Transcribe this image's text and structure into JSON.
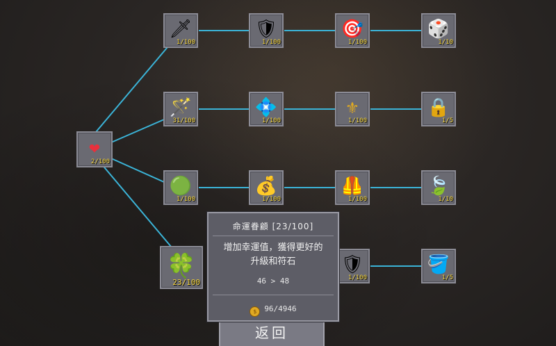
{
  "skill_tree": {
    "root": {
      "icon": "heart-hp-icon",
      "glyph": "❤",
      "count": "2/100"
    },
    "rows": [
      [
        {
          "icon": "sword-icon",
          "glyph": "🗡",
          "count": "1/100"
        },
        {
          "icon": "shield-icon",
          "glyph": "🛡",
          "count": "1/100"
        },
        {
          "icon": "target-icon",
          "glyph": "🎯",
          "count": "1/100"
        },
        {
          "icon": "d20-dice-icon",
          "glyph": "🎲",
          "count": "1/10"
        }
      ],
      [
        {
          "icon": "magic-staff-icon",
          "glyph": "🪄",
          "count": "31/100"
        },
        {
          "icon": "crystal-glass-icon",
          "glyph": "💠",
          "count": "1/100"
        },
        {
          "icon": "slingshot-icon",
          "glyph": "⚜",
          "count": "1/100"
        },
        {
          "icon": "padlock-icon",
          "glyph": "🔒",
          "count": "1/5"
        }
      ],
      [
        {
          "icon": "green-orb-icon",
          "glyph": "🟢",
          "count": "1/100"
        },
        {
          "icon": "money-bag-icon",
          "glyph": "💰",
          "count": "1/100"
        },
        {
          "icon": "armor-icon",
          "glyph": "🦺",
          "count": "1/100"
        },
        {
          "icon": "leaf-icon",
          "glyph": "🍃",
          "count": "1/10"
        }
      ],
      [
        {
          "icon": "four-leaf-clover-icon",
          "glyph": "🍀",
          "count": "23/100"
        },
        {
          "icon": "hidden-node-icon",
          "glyph": "",
          "count": ""
        },
        {
          "icon": "broken-shield-icon",
          "glyph": "🛡",
          "count": "1/100"
        },
        {
          "icon": "bucket-icon",
          "glyph": "🪣",
          "count": "1/5"
        }
      ]
    ]
  },
  "tooltip": {
    "title": "命運眷顧  [23/100]",
    "desc_line1": "增加幸運值，獲得更好的",
    "desc_line2": "升級和符石",
    "stat_change": "46 > 48",
    "coin_icon": "gold-coin-icon",
    "cost": "96/4946"
  },
  "back_button": {
    "label": "返回"
  },
  "colors": {
    "line": "#3bb4d8",
    "count": "#f2d23a",
    "panel": "#6a6a72"
  }
}
